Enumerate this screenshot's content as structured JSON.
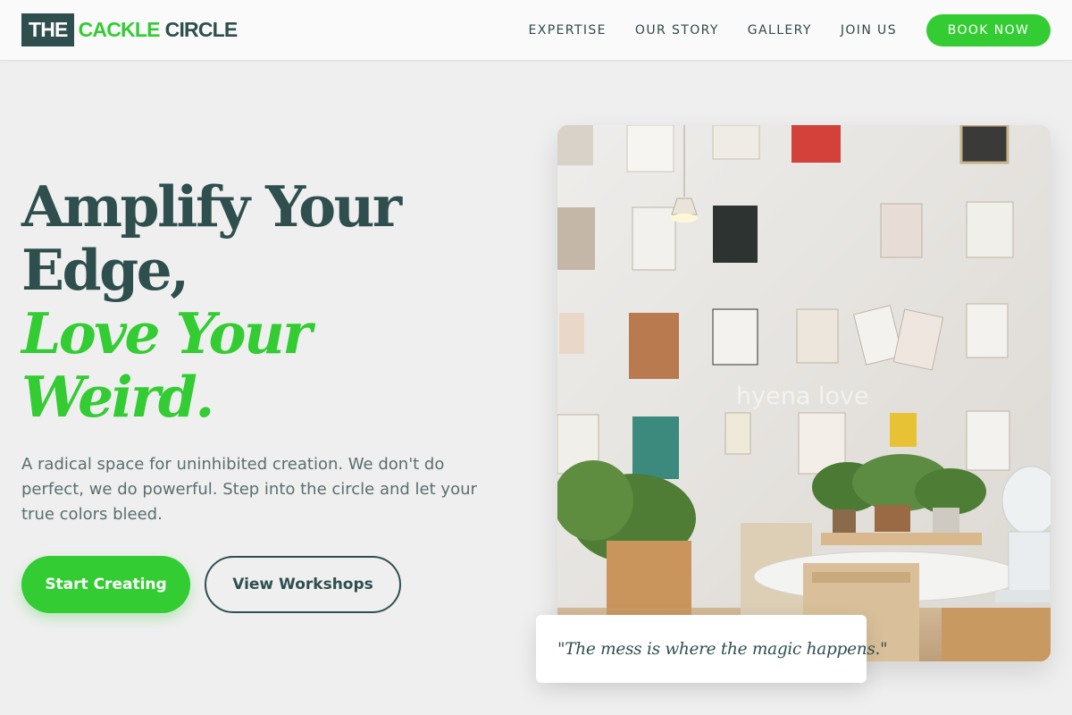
{
  "brand": {
    "box_text": "THE",
    "green_text": "CACKLE",
    "dark_text": "CIRCLE"
  },
  "nav": {
    "items": [
      {
        "label": "EXPERTISE"
      },
      {
        "label": "OUR STORY"
      },
      {
        "label": "GALLERY"
      },
      {
        "label": "JOIN US"
      }
    ],
    "cta_label": "BOOK NOW"
  },
  "hero": {
    "headline_line1": "Amplify Your",
    "headline_line2": "Edge,",
    "headline_accent_line1": "Love Your",
    "headline_accent_line2": "Weird.",
    "subcopy": "A radical space for uninhibited creation. We don't do perfect, we do powerful. Step into the circle and let your true colors bleed.",
    "primary_cta": "Start Creating",
    "secondary_cta": "View Workshops"
  },
  "photo": {
    "watermark": "hyena love",
    "quote": "\"The mess is where the magic happens.\""
  },
  "colors": {
    "brand_green": "#33cc33",
    "brand_dark": "#2f4f4f",
    "background": "#efefef"
  }
}
